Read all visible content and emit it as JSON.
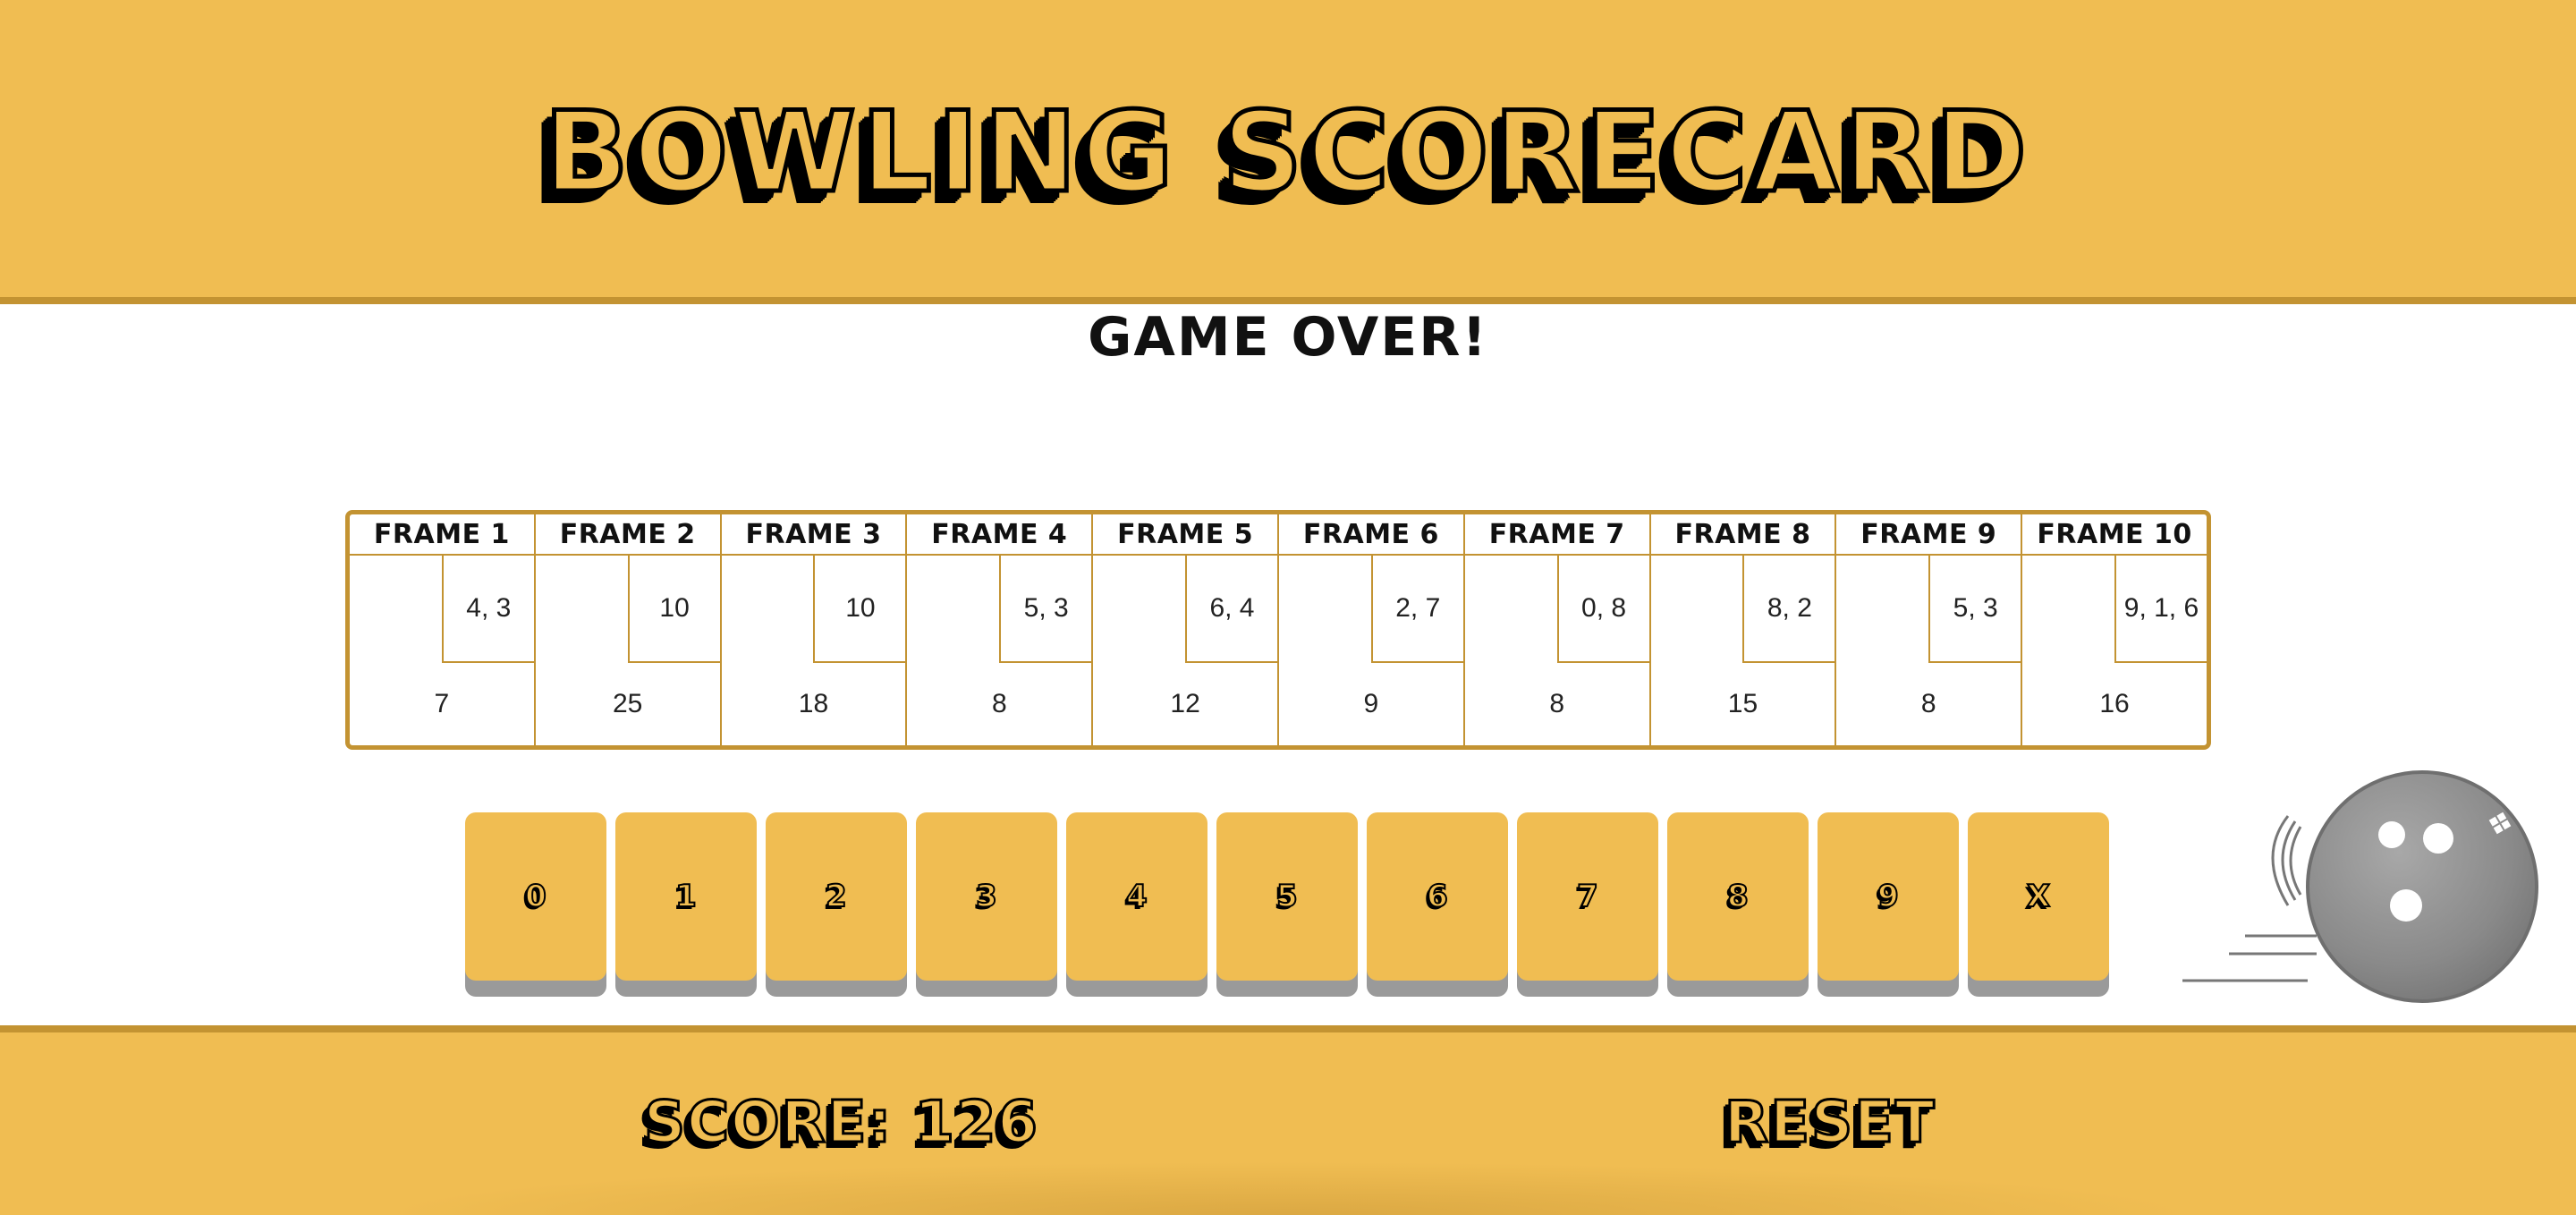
{
  "header": {
    "title": "Bowling Scorecard"
  },
  "status": {
    "message": "GAME OVER!"
  },
  "frames": [
    {
      "label": "FRAME 1",
      "rolls": "4, 3",
      "total": "7"
    },
    {
      "label": "FRAME 2",
      "rolls": "10",
      "total": "25"
    },
    {
      "label": "FRAME 3",
      "rolls": "10",
      "total": "18"
    },
    {
      "label": "FRAME 4",
      "rolls": "5, 3",
      "total": "8"
    },
    {
      "label": "FRAME 5",
      "rolls": "6, 4",
      "total": "12"
    },
    {
      "label": "FRAME 6",
      "rolls": "2, 7",
      "total": "9"
    },
    {
      "label": "FRAME 7",
      "rolls": "0, 8",
      "total": "8"
    },
    {
      "label": "FRAME 8",
      "rolls": "8, 2",
      "total": "15"
    },
    {
      "label": "FRAME 9",
      "rolls": "5, 3",
      "total": "8"
    },
    {
      "label": "FRAME 10",
      "rolls": "9, 1, 6",
      "total": "16"
    }
  ],
  "pin_buttons": [
    "0",
    "1",
    "2",
    "3",
    "4",
    "5",
    "6",
    "7",
    "8",
    "9",
    "X"
  ],
  "footer": {
    "score_text": "SCORE: 126",
    "reset_label": "RESET"
  },
  "colors": {
    "accent": "#F0BD52",
    "border": "#C39332",
    "button_shadow": "#9A9A9A",
    "ball": "#8A8A8A"
  },
  "icons": {
    "ball": "bowling-ball-icon"
  }
}
